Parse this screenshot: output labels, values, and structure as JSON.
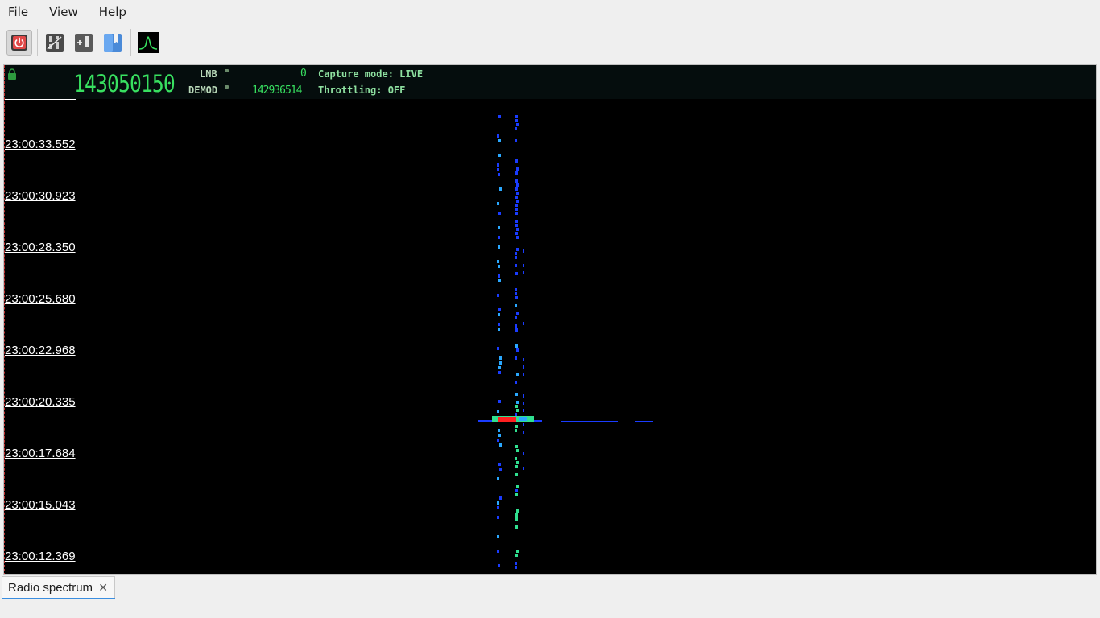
{
  "menubar": {
    "items": [
      {
        "label": "File"
      },
      {
        "label": "View"
      },
      {
        "label": "Help"
      }
    ]
  },
  "toolbar": {
    "buttons": [
      {
        "icon": "power-icon",
        "pressed": true
      },
      {
        "icon": "settings-panel-icon",
        "pressed": false
      },
      {
        "icon": "add-bookmark-icon",
        "pressed": false
      },
      {
        "icon": "bookmarks-icon",
        "pressed": false
      },
      {
        "icon": "spectrum-icon",
        "pressed": false
      }
    ]
  },
  "lcd": {
    "main_frequency": "143050150",
    "lnb_label": "LNB",
    "lnb_value": "0",
    "demod_label": "DEMOD",
    "demod_value": "142936514",
    "capture_mode": "Capture mode: LIVE",
    "throttling": "Throttling: OFF"
  },
  "waterfall": {
    "time_labels": [
      "23:00:33.552",
      "23:00:30.923",
      "23:00:28.350",
      "23:00:25.680",
      "23:00:22.968",
      "23:00:20.335",
      "23:00:17.684",
      "23:00:15.043",
      "23:00:12.369"
    ],
    "colors": {
      "background": "#000000",
      "weak": "#1a3cff",
      "medium": "#2aa8ff",
      "strong": "#30e090",
      "peak": "#ff2020"
    }
  },
  "tabs": [
    {
      "label": "Radio spectrum",
      "close_icon": "close-icon",
      "active": true
    }
  ]
}
